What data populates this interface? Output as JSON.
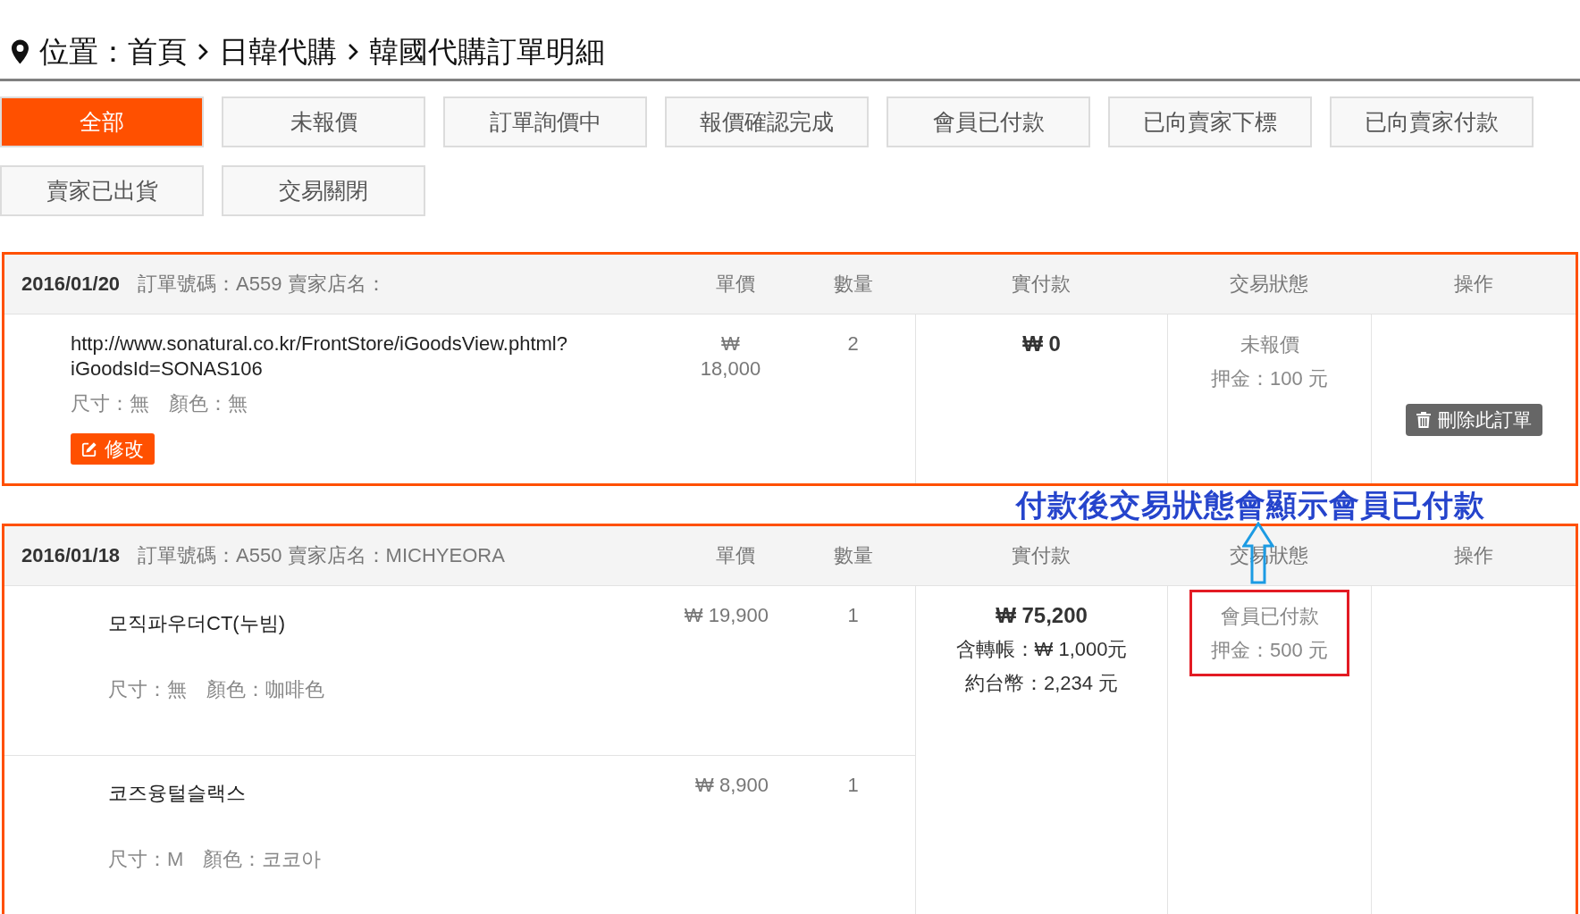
{
  "breadcrumb": {
    "label": "位置：",
    "items": [
      {
        "label": "首頁"
      },
      {
        "label": "日韓代購"
      },
      {
        "label": "韓國代購訂單明細"
      }
    ]
  },
  "status_tabs": [
    {
      "label": "全部",
      "selected": true
    },
    {
      "label": "未報價",
      "selected": false
    },
    {
      "label": "訂單詢價中",
      "selected": false
    },
    {
      "label": "報價確認完成",
      "selected": false
    },
    {
      "label": "會員已付款",
      "selected": false
    },
    {
      "label": "已向賣家下標",
      "selected": false
    },
    {
      "label": "已向賣家付款",
      "selected": false
    },
    {
      "label": "賣家已出貨",
      "selected": false
    },
    {
      "label": "交易關閉",
      "selected": false
    }
  ],
  "orders": [
    {
      "date": "2016/01/20",
      "info": "訂單號碼：A559 賣家店名：",
      "columns": [
        "單價",
        "數量",
        "實付款",
        "交易狀態",
        "操作"
      ],
      "items": [
        {
          "kind": "url",
          "description": "http://www.sonatural.co.kr/FrontStore/iGoodsView.phtml?iGoodsId=SONAS106",
          "options": "尺寸：無　顏色：無",
          "unit_price": "₩ 18,000",
          "quantity": "2",
          "edit_button": "修改"
        }
      ],
      "payment": {
        "total": "₩ 0"
      },
      "status": {
        "label": "未報價",
        "deposit": "押金：100 元",
        "highlighted": false
      },
      "delete_button": "刪除此訂單"
    },
    {
      "callout": {
        "text": "付款後交易狀態會顯示會員已付款"
      },
      "date": "2016/01/18",
      "info": "訂單號碼：A550 賣家店名：MICHYEORA",
      "columns": [
        "單價",
        "數量",
        "實付款",
        "交易狀態",
        "操作"
      ],
      "items": [
        {
          "kind": "product",
          "description": "모직파우더CT(누빔)",
          "options": "尺寸：無　顏色：咖啡色",
          "unit_price": "₩ 19,900",
          "quantity": "1"
        },
        {
          "kind": "product",
          "description": "코즈융털슬랙스",
          "options": "尺寸：M　顏色：코코아",
          "unit_price": "₩ 8,900",
          "quantity": "1"
        }
      ],
      "payment": {
        "total": "₩ 75,200",
        "transfer": "含轉帳：₩ 1,000元",
        "estimate": "約台幣：2,234 元"
      },
      "status": {
        "label": "會員已付款",
        "deposit": "押金：500 元",
        "highlighted": true
      }
    }
  ]
}
